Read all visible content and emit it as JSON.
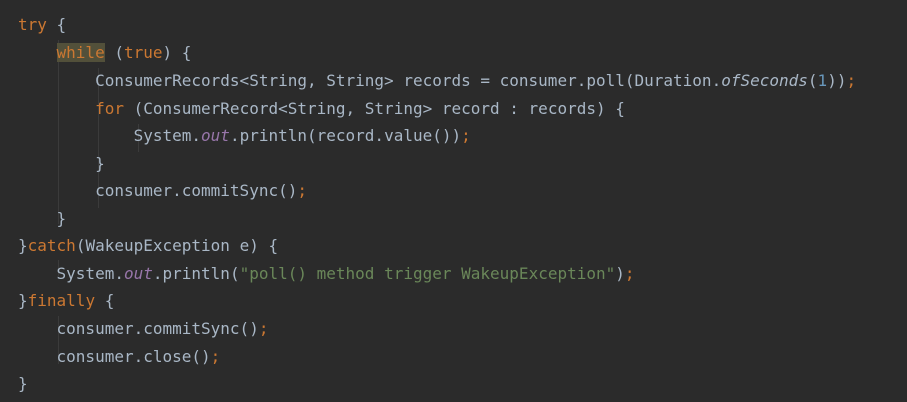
{
  "editor": {
    "theme": "Darcula",
    "colors": {
      "background": "#2b2b2b",
      "keyword": "#cc7832",
      "text": "#a9b7c6",
      "string": "#6a8759",
      "number": "#6897bb",
      "field": "#9876aa",
      "highlight": "#52503a"
    },
    "lines": [
      [
        {
          "t": "try",
          "c": "kw"
        },
        {
          "t": " {"
        }
      ],
      [
        {
          "t": "    "
        },
        {
          "t": "while",
          "c": "kw hl"
        },
        {
          "t": " ("
        },
        {
          "t": "true",
          "c": "kw"
        },
        {
          "t": ") {"
        }
      ],
      [
        {
          "t": "        ConsumerRecords<String, String> records = consumer.poll(Duration."
        },
        {
          "t": "ofSeconds",
          "c": "stat"
        },
        {
          "t": "("
        },
        {
          "t": "1",
          "c": "num"
        },
        {
          "t": "))"
        },
        {
          "t": ";",
          "c": "punc"
        }
      ],
      [
        {
          "t": "        "
        },
        {
          "t": "for",
          "c": "kw"
        },
        {
          "t": " (ConsumerRecord<String, String> record : records) {"
        }
      ],
      [
        {
          "t": "            System."
        },
        {
          "t": "out",
          "c": "field"
        },
        {
          "t": ".println(record.value())"
        },
        {
          "t": ";",
          "c": "punc"
        }
      ],
      [
        {
          "t": "        }"
        }
      ],
      [
        {
          "t": "        consumer.commitSync()"
        },
        {
          "t": ";",
          "c": "punc"
        }
      ],
      [
        {
          "t": "    }"
        }
      ],
      [
        {
          "t": "}"
        },
        {
          "t": "catch",
          "c": "kw"
        },
        {
          "t": "(WakeupException e) {"
        }
      ],
      [
        {
          "t": "    System."
        },
        {
          "t": "out",
          "c": "field"
        },
        {
          "t": ".println("
        },
        {
          "t": "\"poll() method trigger WakeupException\"",
          "c": "str"
        },
        {
          "t": ")"
        },
        {
          "t": ";",
          "c": "punc"
        }
      ],
      [
        {
          "t": "}"
        },
        {
          "t": "finally",
          "c": "kw"
        },
        {
          "t": " {"
        }
      ],
      [
        {
          "t": "    consumer.commitSync()"
        },
        {
          "t": ";",
          "c": "punc"
        }
      ],
      [
        {
          "t": "    consumer.close()"
        },
        {
          "t": ";",
          "c": "punc"
        }
      ],
      [
        {
          "t": "}"
        }
      ]
    ]
  }
}
